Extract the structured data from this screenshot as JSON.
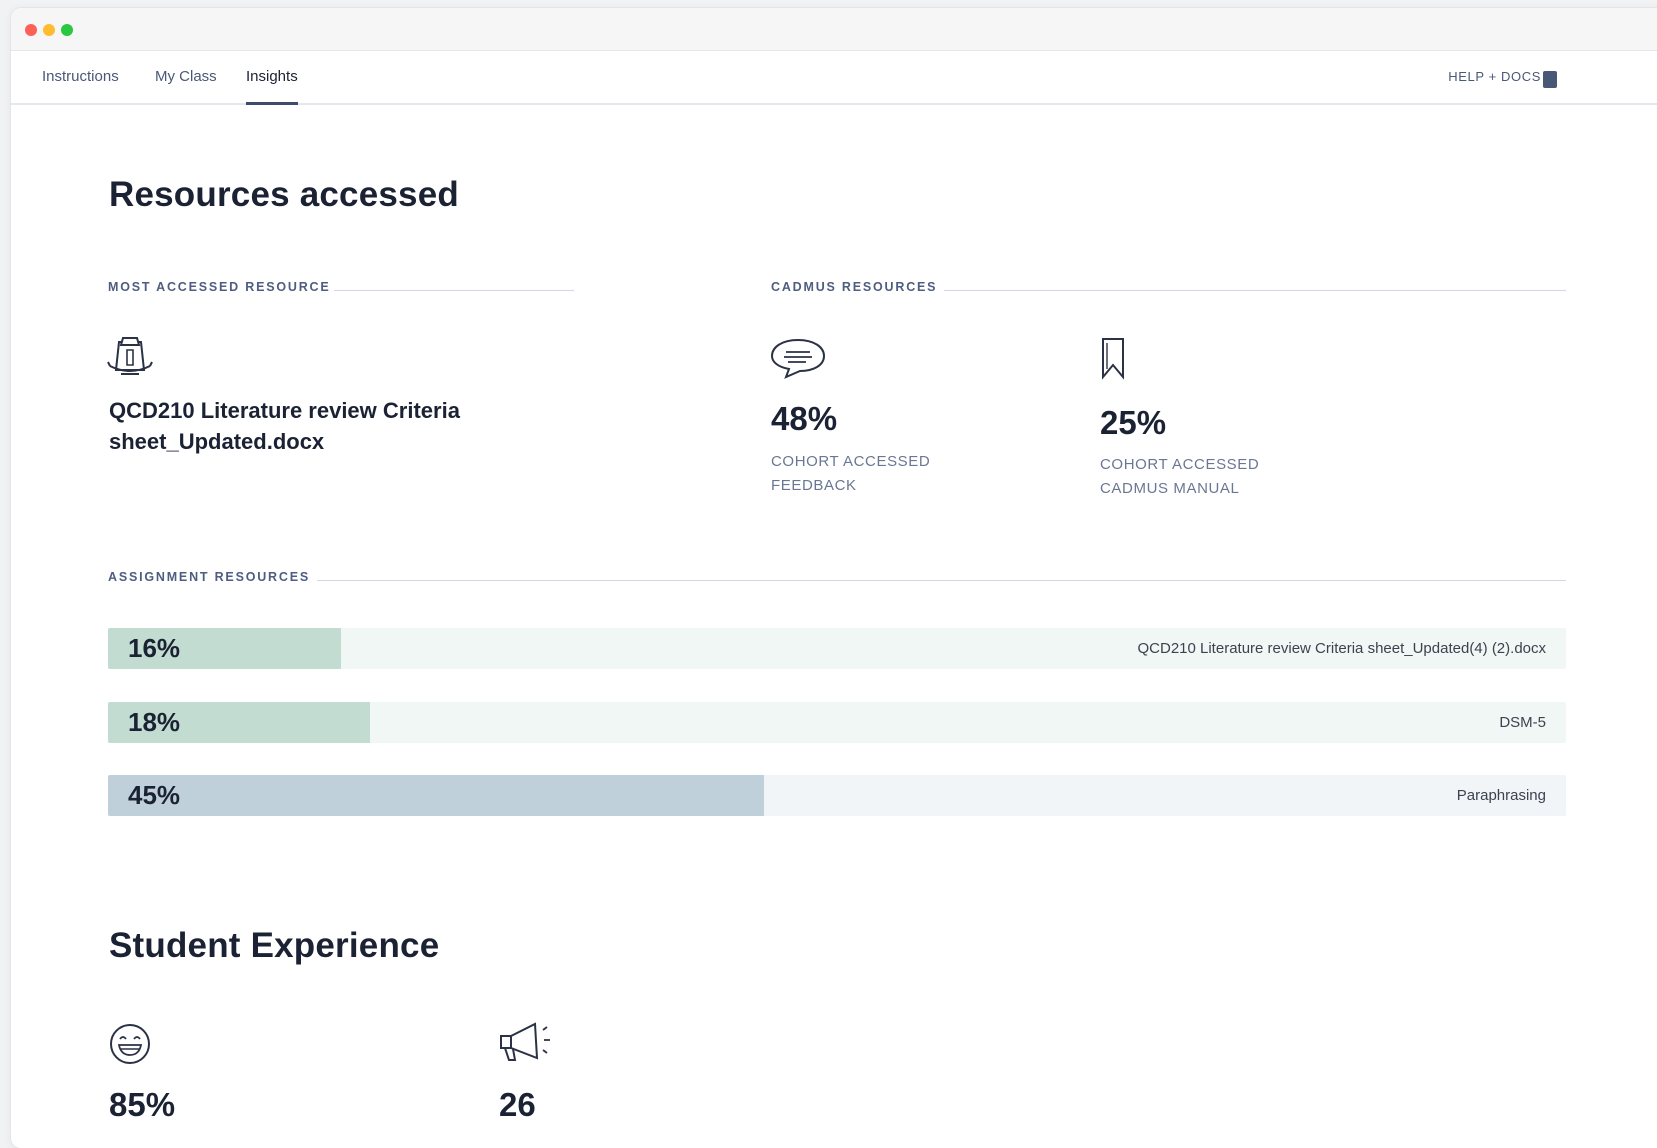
{
  "nav": {
    "tabs": [
      {
        "label": "Instructions"
      },
      {
        "label": "My Class"
      },
      {
        "label": "Insights"
      }
    ],
    "active_tab": "Insights",
    "help_label": "HELP + DOCS",
    "help_icon": "book-icon"
  },
  "resources": {
    "heading": "Resources accessed",
    "most_accessed": {
      "label": "MOST ACCESSED RESOURCE",
      "icon": "rank-one-badge-icon",
      "name": "QCD210 Literature review Criteria sheet_Updated.docx"
    },
    "cadmus": {
      "label": "CADMUS RESOURCES",
      "items": [
        {
          "icon": "speech-bubble-icon",
          "value": "48%",
          "caption_line1": "COHORT ACCESSED",
          "caption_line2": "FEEDBACK"
        },
        {
          "icon": "bookmark-icon",
          "value": "25%",
          "caption_line1": "COHORT ACCESSED",
          "caption_line2": "CADMUS MANUAL"
        }
      ]
    },
    "assignment": {
      "label": "ASSIGNMENT RESOURCES",
      "bars": [
        {
          "pct_label": "16%",
          "fraction": 0.16,
          "name": "QCD210 Literature review Criteria sheet_Updated(4) (2).docx",
          "fill": "#c2dcd2",
          "track": "#f1f7f4"
        },
        {
          "pct_label": "18%",
          "fraction": 0.18,
          "name": "DSM-5",
          "fill": "#c2dcd2",
          "track": "#f1f7f4"
        },
        {
          "pct_label": "45%",
          "fraction": 0.45,
          "name": "Paraphrasing",
          "fill": "#c0d0da",
          "track": "#f1f5f8"
        }
      ]
    }
  },
  "experience": {
    "heading": "Student Experience",
    "items": [
      {
        "icon": "grinning-face-icon",
        "value": "85%"
      },
      {
        "icon": "megaphone-icon",
        "value": "26"
      }
    ]
  }
}
